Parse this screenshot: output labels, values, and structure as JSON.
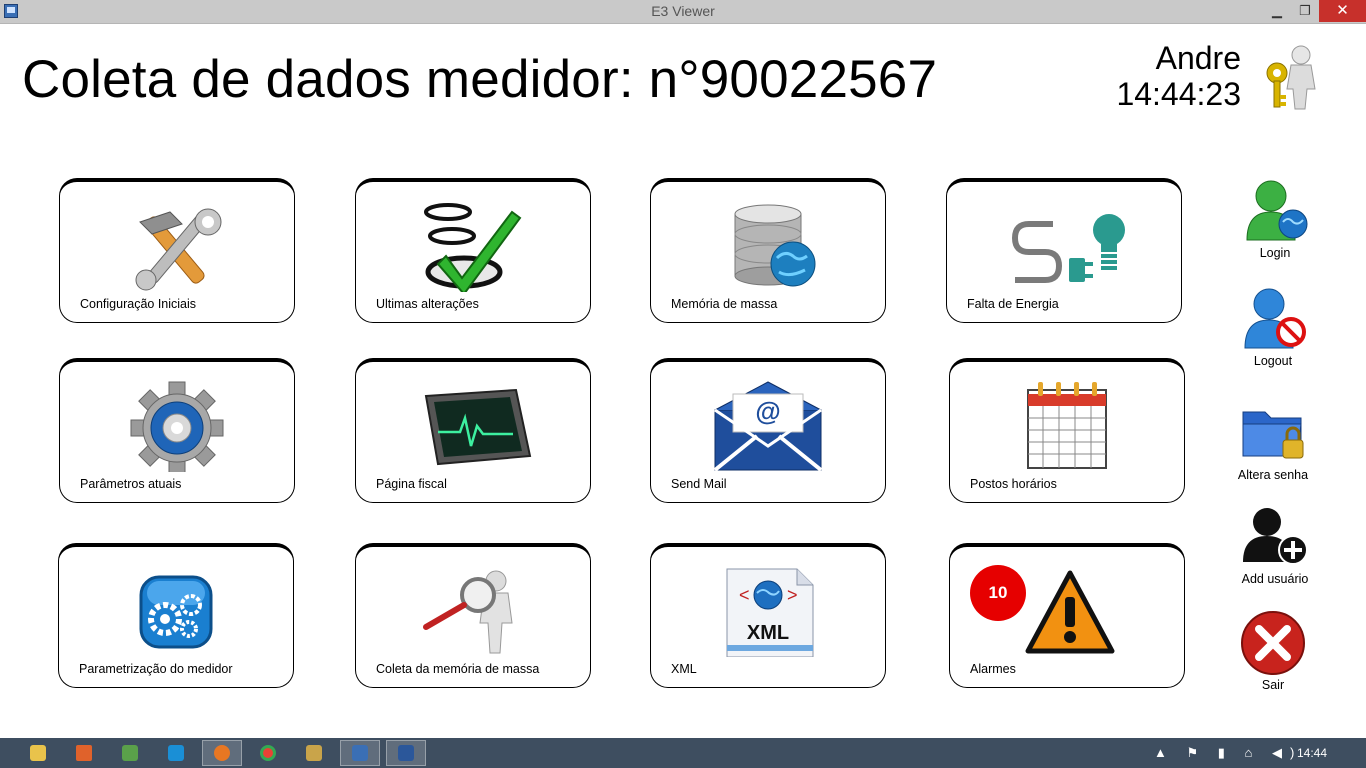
{
  "window": {
    "title": "E3 Viewer",
    "min_glyph": "▁",
    "max_glyph": "❐",
    "close_glyph": "✕"
  },
  "header": {
    "title": "Coleta de dados medidor: n°90022567",
    "user": "Andre",
    "time": "14:44:23"
  },
  "tiles": [
    {
      "label": "Configuração Iniciais",
      "icon": "tools-icon"
    },
    {
      "label": "Ultimas alterações",
      "icon": "checklist-icon"
    },
    {
      "label": "Memória de massa",
      "icon": "database-globe-icon"
    },
    {
      "label": "Falta de Energia",
      "icon": "plug-bulb-icon"
    },
    {
      "label": "Parâmetros atuais",
      "icon": "gear-icon"
    },
    {
      "label": "Página fiscal",
      "icon": "monitor-ecg-icon"
    },
    {
      "label": "Send Mail",
      "icon": "mail-icon"
    },
    {
      "label": "Postos horários",
      "icon": "calendar-icon"
    },
    {
      "label": "Parametrização do medidor",
      "icon": "gears-button-icon"
    },
    {
      "label": "Coleta da memória de massa",
      "icon": "magnifier-person-icon"
    },
    {
      "label": "XML",
      "icon": "xml-file-icon"
    },
    {
      "label": "Alarmes",
      "icon": "warning-icon",
      "badge": "10"
    }
  ],
  "sidebar": {
    "login": "Login",
    "logout": "Logout",
    "change_password": "Altera senha",
    "add_user": "Add usuário",
    "exit": "Sair"
  },
  "taskbar": {
    "clock": "14:44",
    "tray_icons": "▲ ⚑ ▮ ⌂ ◀)",
    "items": [
      "file-explorer",
      "matlab",
      "app",
      "app2",
      "firefox",
      "chrome",
      "tool",
      "e3-viewer",
      "word"
    ]
  },
  "colors": {
    "taskbar": "#3e4e60",
    "close": "#c7302b",
    "badge": "#e60000"
  }
}
